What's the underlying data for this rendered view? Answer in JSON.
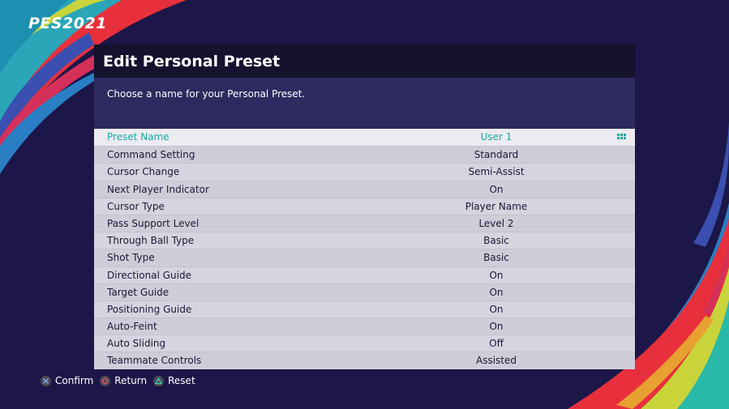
{
  "logo": "PES2021",
  "panel": {
    "title": "Edit Personal Preset",
    "description": "Choose a name for your Personal Preset."
  },
  "settings": [
    {
      "label": "Preset Name",
      "value": "User 1"
    },
    {
      "label": "Command Setting",
      "value": "Standard"
    },
    {
      "label": "Cursor Change",
      "value": "Semi-Assist"
    },
    {
      "label": "Next Player Indicator",
      "value": "On"
    },
    {
      "label": "Cursor Type",
      "value": "Player Name"
    },
    {
      "label": "Pass Support Level",
      "value": "Level 2"
    },
    {
      "label": "Through Ball Type",
      "value": "Basic"
    },
    {
      "label": "Shot Type",
      "value": "Basic"
    },
    {
      "label": "Directional Guide",
      "value": "On"
    },
    {
      "label": "Target Guide",
      "value": "On"
    },
    {
      "label": "Positioning Guide",
      "value": "On"
    },
    {
      "label": "Auto-Feint",
      "value": "On"
    },
    {
      "label": "Auto Sliding",
      "value": "Off"
    },
    {
      "label": "Teammate Controls",
      "value": "Assisted"
    }
  ],
  "footer": {
    "confirm": "Confirm",
    "return": "Return",
    "reset": "Reset"
  },
  "colors": {
    "background": "#1c1748",
    "selected_text": "#1aa89e",
    "header_bg": "#14122e",
    "description_bg": "#2d2a5f"
  }
}
